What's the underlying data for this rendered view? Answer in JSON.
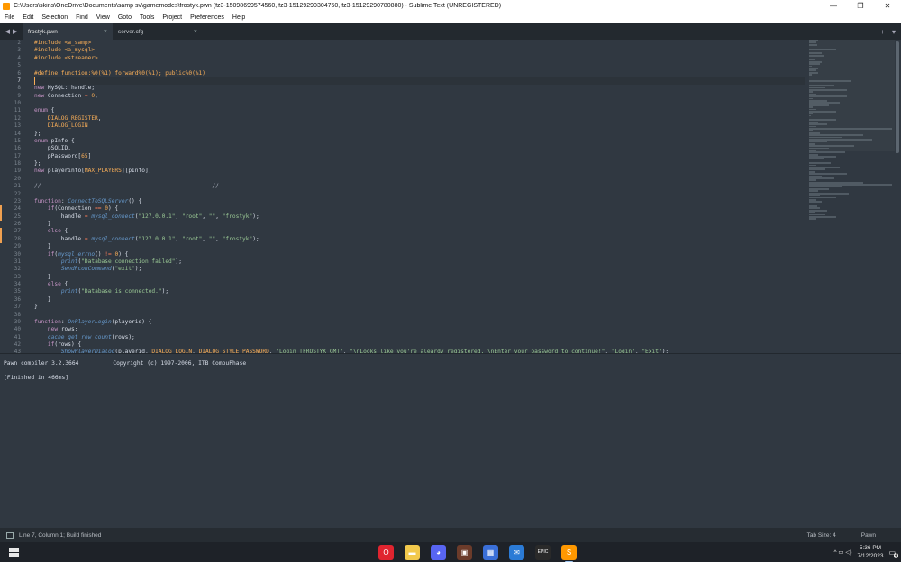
{
  "window": {
    "title": "C:\\Users\\skins\\OneDrive\\Documents\\samp sv\\gamemodes\\frostyk.pwn (fz3-15098699574560, fz3-15129290304750, fz3-15129290780880) - Sublime Text (UNREGISTERED)",
    "minimize": "—",
    "maximize": "❐",
    "close": "✕"
  },
  "menu": [
    "File",
    "Edit",
    "Selection",
    "Find",
    "View",
    "Goto",
    "Tools",
    "Project",
    "Preferences",
    "Help"
  ],
  "tabs": [
    {
      "label": "frostyk.pwn",
      "active": true,
      "close": "×"
    },
    {
      "label": "server.cfg",
      "active": false,
      "close": "×"
    }
  ],
  "tab_nav": {
    "prev": "◀",
    "next": "▶",
    "new": "+",
    "more": "▾"
  },
  "editor": {
    "line_numbers": [
      "2",
      "3",
      "4",
      "5",
      "6",
      "7",
      "8",
      "9",
      "10",
      "11",
      "12",
      "13",
      "14",
      "15",
      "16",
      "17",
      "18",
      "19",
      "20",
      "21",
      "22",
      "23",
      "24",
      "25",
      "26",
      "27",
      "28",
      "29",
      "30",
      "31",
      "32",
      "33",
      "34",
      "35",
      "36",
      "37",
      "38",
      "39",
      "40",
      "41",
      "42",
      "43",
      "44"
    ]
  },
  "output": {
    "line1": "Pawn compiler 3.2.3664          Copyright (c) 1997-2006, ITB CompuPhase",
    "line2": "[Finished in 466ms]"
  },
  "status": {
    "position": "Line 7, Column 1; Build finished",
    "tab_size": "Tab Size: 4",
    "syntax": "Pawn"
  },
  "taskbar": {
    "apps": [
      {
        "name": "opera-icon",
        "glyph": "O",
        "color": "#e0242f"
      },
      {
        "name": "file-explorer-icon",
        "glyph": "▬",
        "color": "#f2c94c"
      },
      {
        "name": "discord-icon",
        "glyph": "◕",
        "color": "#5865f2"
      },
      {
        "name": "game-icon",
        "glyph": "▣",
        "color": "#6b3b2a"
      },
      {
        "name": "store-icon",
        "glyph": "▦",
        "color": "#3a6fd8"
      },
      {
        "name": "mail-icon",
        "glyph": "✉",
        "color": "#2b7bd6"
      },
      {
        "name": "epic-games-icon",
        "glyph": "EPIC",
        "color": "#2a2a2a"
      },
      {
        "name": "sublime-icon",
        "glyph": "S",
        "color": "#ff9800"
      }
    ],
    "time": "5:36 PM",
    "date": "7/12/2023",
    "notifications": "4",
    "tray_icons": "^  ▭  ◁)"
  }
}
